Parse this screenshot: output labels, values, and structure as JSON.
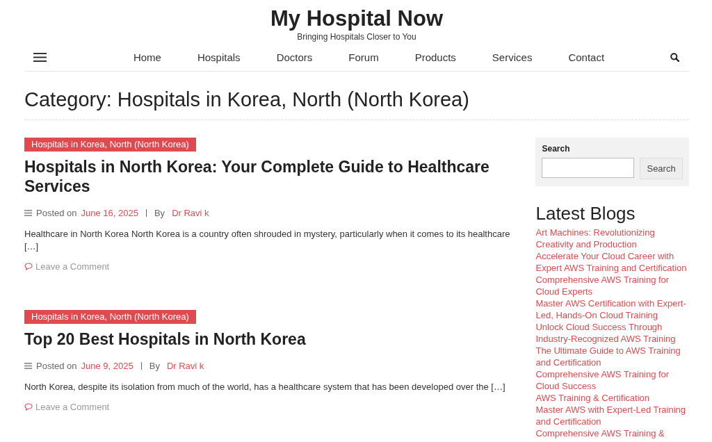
{
  "site": {
    "title": "My Hospital Now",
    "tagline": "Bringing Hospitals Closer to You"
  },
  "nav": [
    "Home",
    "Hospitals",
    "Doctors",
    "Forum",
    "Products",
    "Services",
    "Contact"
  ],
  "page_title": "Category: Hospitals in Korea, North (North Korea)",
  "posts": [
    {
      "category": "Hospitals in Korea, North (North Korea)",
      "title": "Hospitals in North Korea: Your Complete Guide to Healthcare Services",
      "posted_on": "Posted on",
      "date": "June 16, 2025",
      "by": "By",
      "author": "Dr Ravi k",
      "excerpt": "Healthcare in North Korea North Korea is a country often shrouded in mystery, particularly when it comes to its healthcare […]",
      "comment_link": "Leave a Comment"
    },
    {
      "category": "Hospitals in Korea, North (North Korea)",
      "title": "Top 20 Best Hospitals in North Korea",
      "posted_on": "Posted on",
      "date": "June 9, 2025",
      "by": "By",
      "author": "Dr Ravi k",
      "excerpt": "North Korea, despite its isolation from much of the world, has a healthcare system that has been developed over the […]",
      "comment_link": "Leave a Comment"
    }
  ],
  "sidebar": {
    "search": {
      "label": "Search",
      "button": "Search"
    },
    "latest_blogs": {
      "title": "Latest Blogs",
      "items": [
        "Art Machines: Revolutionizing Creativity and Production",
        "Accelerate Your Cloud Career with Expert AWS Training and Certification",
        "Comprehensive AWS Training for Cloud Experts",
        "Master AWS Certification with Expert-Led, Hands-On Cloud Training",
        "Unlock Cloud Success Through Industry-Recognized AWS Training",
        "The Ultimate Guide to AWS Training and Certification",
        "Comprehensive AWS Training for Cloud Success",
        "AWS Training & Certification",
        "Master AWS with Expert-Led Training and Certification",
        "Comprehensive AWS Training &"
      ]
    }
  }
}
